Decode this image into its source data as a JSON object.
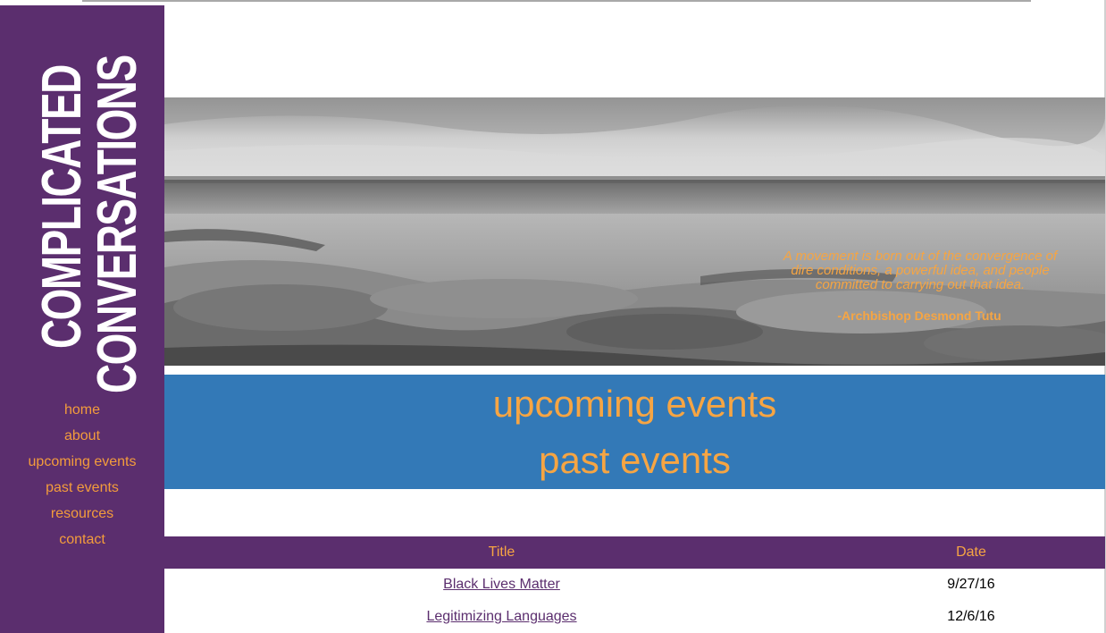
{
  "logo": {
    "line1": "COMPLICATED",
    "line2": "CONVERSATIONS"
  },
  "nav": {
    "items": [
      {
        "label": "home"
      },
      {
        "label": "about"
      },
      {
        "label": "upcoming events"
      },
      {
        "label": "past events"
      },
      {
        "label": "resources"
      },
      {
        "label": "contact"
      }
    ]
  },
  "hero": {
    "image": "grayscale-shoreline-landscape",
    "quote": "A movement is born out of the convergence of dire conditions, a powerful idea, and people committed to carrying out that idea.",
    "author": "-Archbishop Desmond Tutu"
  },
  "events": {
    "upcoming_label": "upcoming events",
    "past_label": "past events"
  },
  "table": {
    "headers": {
      "title": "Title",
      "date": "Date"
    },
    "rows": [
      {
        "title": "Black Lives Matter",
        "date": "9/27/16"
      },
      {
        "title": "Legitimizing Languages",
        "date": "12/6/16"
      }
    ]
  },
  "colors": {
    "sidebar": "#5b2e6e",
    "accent": "#f6a543",
    "band": "#3379b7",
    "link": "#5b2e6e"
  }
}
